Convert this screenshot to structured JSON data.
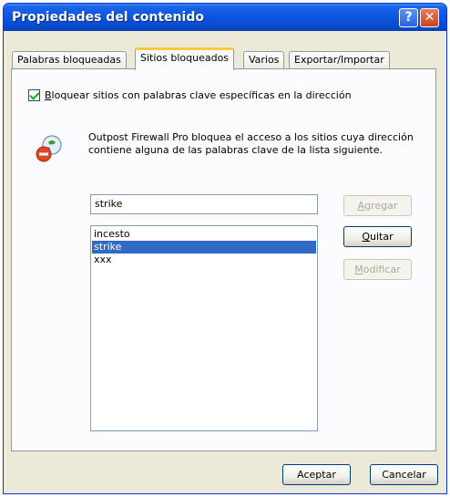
{
  "window": {
    "title": "Propiedades del contenido",
    "help_glyph": "?",
    "close_glyph": "✕"
  },
  "tabs": [
    {
      "label": "Palabras bloqueadas"
    },
    {
      "label": "Sitios bloqueados"
    },
    {
      "label": "Varios"
    },
    {
      "label": "Exportar/Importar"
    }
  ],
  "active_tab": "Sitios bloqueados",
  "checkbox": {
    "first_letter": "B",
    "rest": "loquear sitios con palabras clave específicas en la dirección",
    "checked": true
  },
  "info_icon": "info-shield-icon",
  "description": "Outpost Firewall Pro bloquea el acceso a los sitios cuya dirección contiene alguna de las palabras clave de la lista siguiente.",
  "keyword_input": {
    "value": "strike"
  },
  "keywords": [
    {
      "text": "incesto",
      "selected": false
    },
    {
      "text": "strike",
      "selected": true
    },
    {
      "text": "xxx",
      "selected": false
    }
  ],
  "buttons": {
    "add": {
      "first": "A",
      "rest": "gregar",
      "enabled": false
    },
    "remove": {
      "first": "Q",
      "rest": "uitar",
      "enabled": true
    },
    "modify": {
      "first": "M",
      "rest": "odificar",
      "enabled": false
    },
    "ok": "Aceptar",
    "cancel": "Cancelar"
  },
  "colors": {
    "titlebar": "#0a53df",
    "selection": "#316ac5",
    "dialog_bg": "#ece9d8",
    "active_tab_accent": "#ffc83c"
  }
}
